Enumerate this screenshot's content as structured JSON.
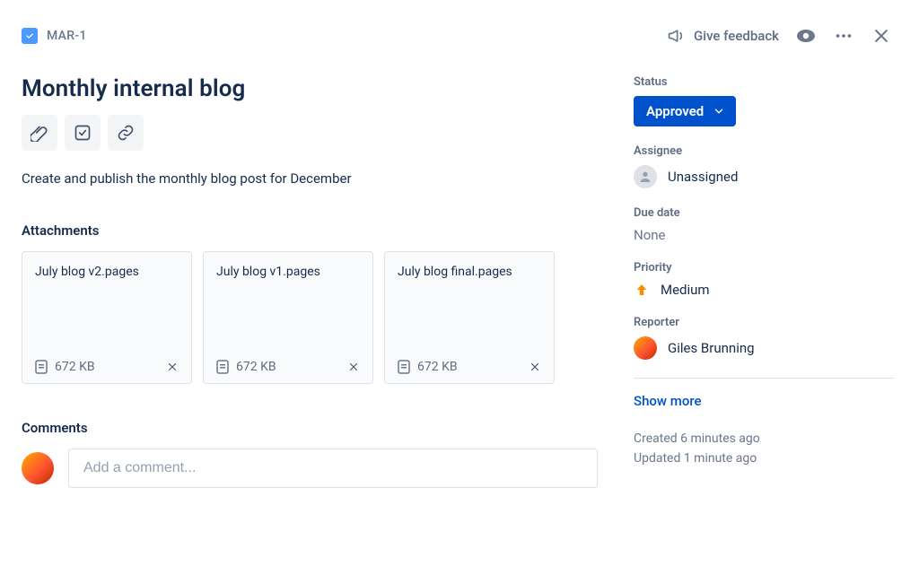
{
  "issue": {
    "key": "MAR-1",
    "title": "Monthly internal blog",
    "description": "Create and publish the monthly blog post for December"
  },
  "header": {
    "feedback_label": "Give feedback"
  },
  "sections": {
    "attachments_label": "Attachments",
    "comments_label": "Comments"
  },
  "attachments": [
    {
      "name": "July blog v2.pages",
      "size": "672 KB"
    },
    {
      "name": "July blog v1.pages",
      "size": "672 KB"
    },
    {
      "name": "July blog final.pages",
      "size": "672 KB"
    }
  ],
  "comments": {
    "placeholder": "Add a comment..."
  },
  "side": {
    "status_label": "Status",
    "status_value": "Approved",
    "assignee_label": "Assignee",
    "assignee_value": "Unassigned",
    "due_label": "Due date",
    "due_value": "None",
    "priority_label": "Priority",
    "priority_value": "Medium",
    "reporter_label": "Reporter",
    "reporter_value": "Giles Brunning",
    "show_more": "Show more",
    "created": "Created 6 minutes ago",
    "updated": "Updated 1 minute ago"
  },
  "icons": {
    "attach": "attach-icon",
    "subtask": "subtask-icon",
    "link": "link-icon",
    "watch": "watch-icon",
    "more": "more-icon",
    "close": "close-icon",
    "megaphone": "megaphone-icon",
    "doc": "doc-icon",
    "arrow_up": "priority-medium-icon",
    "check": "check-icon",
    "person": "person-icon",
    "chevron_down": "chevron-down-icon"
  }
}
